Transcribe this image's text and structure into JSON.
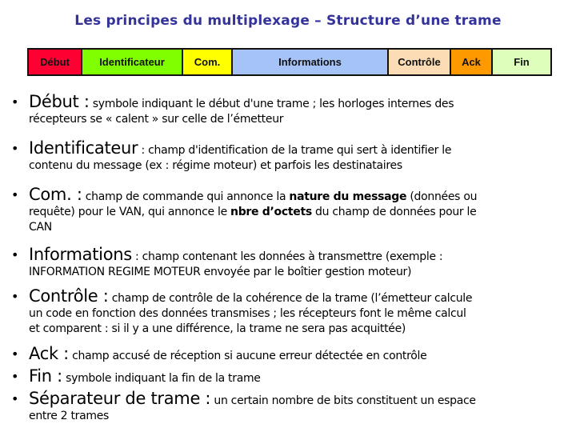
{
  "title": "Les principes du multiplexage – Structure d’une trame",
  "frame": {
    "segments": [
      {
        "label": "Début",
        "color": "#ff0033"
      },
      {
        "label": "Identificateur",
        "color": "#80ff00"
      },
      {
        "label": "Com.",
        "color": "#ffff00"
      },
      {
        "label": "Informations",
        "color": "#a6c3f7"
      },
      {
        "label": "Contrôle",
        "color": "#fbdcb5"
      },
      {
        "label": "Ack",
        "color": "#ff9900"
      },
      {
        "label": "Fin",
        "color": "#ddffbb"
      }
    ]
  },
  "items": [
    {
      "term": "Début :",
      "desc": " symbole indiquant le début d'une trame ; les horloges internes des",
      "cont": "récepteurs se « calent » sur celle de l’émetteur"
    },
    {
      "term": "Identificateur",
      "desc": " : champ d'identification de la trame qui sert à identifier le",
      "cont": "contenu du message (ex : régime moteur) et parfois les destinataires"
    },
    {
      "term": "Com. :",
      "desc_a": " champ de commande qui annonce la ",
      "bold_a": "nature du message",
      "desc_b": " (données ou",
      "cont_a": "requête) pour le VAN, qui annonce le ",
      "bold_b": "nbre d’octets",
      "cont_b": " du champ de données pour le",
      "cont_c": "CAN"
    },
    {
      "term": "Informations",
      "desc": " : champ contenant les données à transmettre (exemple :",
      "cont": "INFORMATION REGIME MOTEUR envoyée par le boîtier gestion moteur)"
    },
    {
      "term": "Contrôle :",
      "desc": " champ de contrôle de la cohérence de la trame (l’émetteur calcule",
      "cont": "un code en fonction des données transmises ; les récepteurs font le même calcul",
      "cont2": "et comparent : si il y a une différence, la trame ne sera pas acquittée)"
    },
    {
      "term": "Ack :",
      "desc": " champ accusé de réception si aucune erreur détectée en contrôle"
    },
    {
      "term": "Fin :",
      "desc": " symbole indiquant la fin de la trame"
    },
    {
      "term": "Séparateur de trame :",
      "desc": " un certain nombre de bits constituent un espace",
      "cont": "entre 2 trames"
    }
  ],
  "bullet": "•"
}
